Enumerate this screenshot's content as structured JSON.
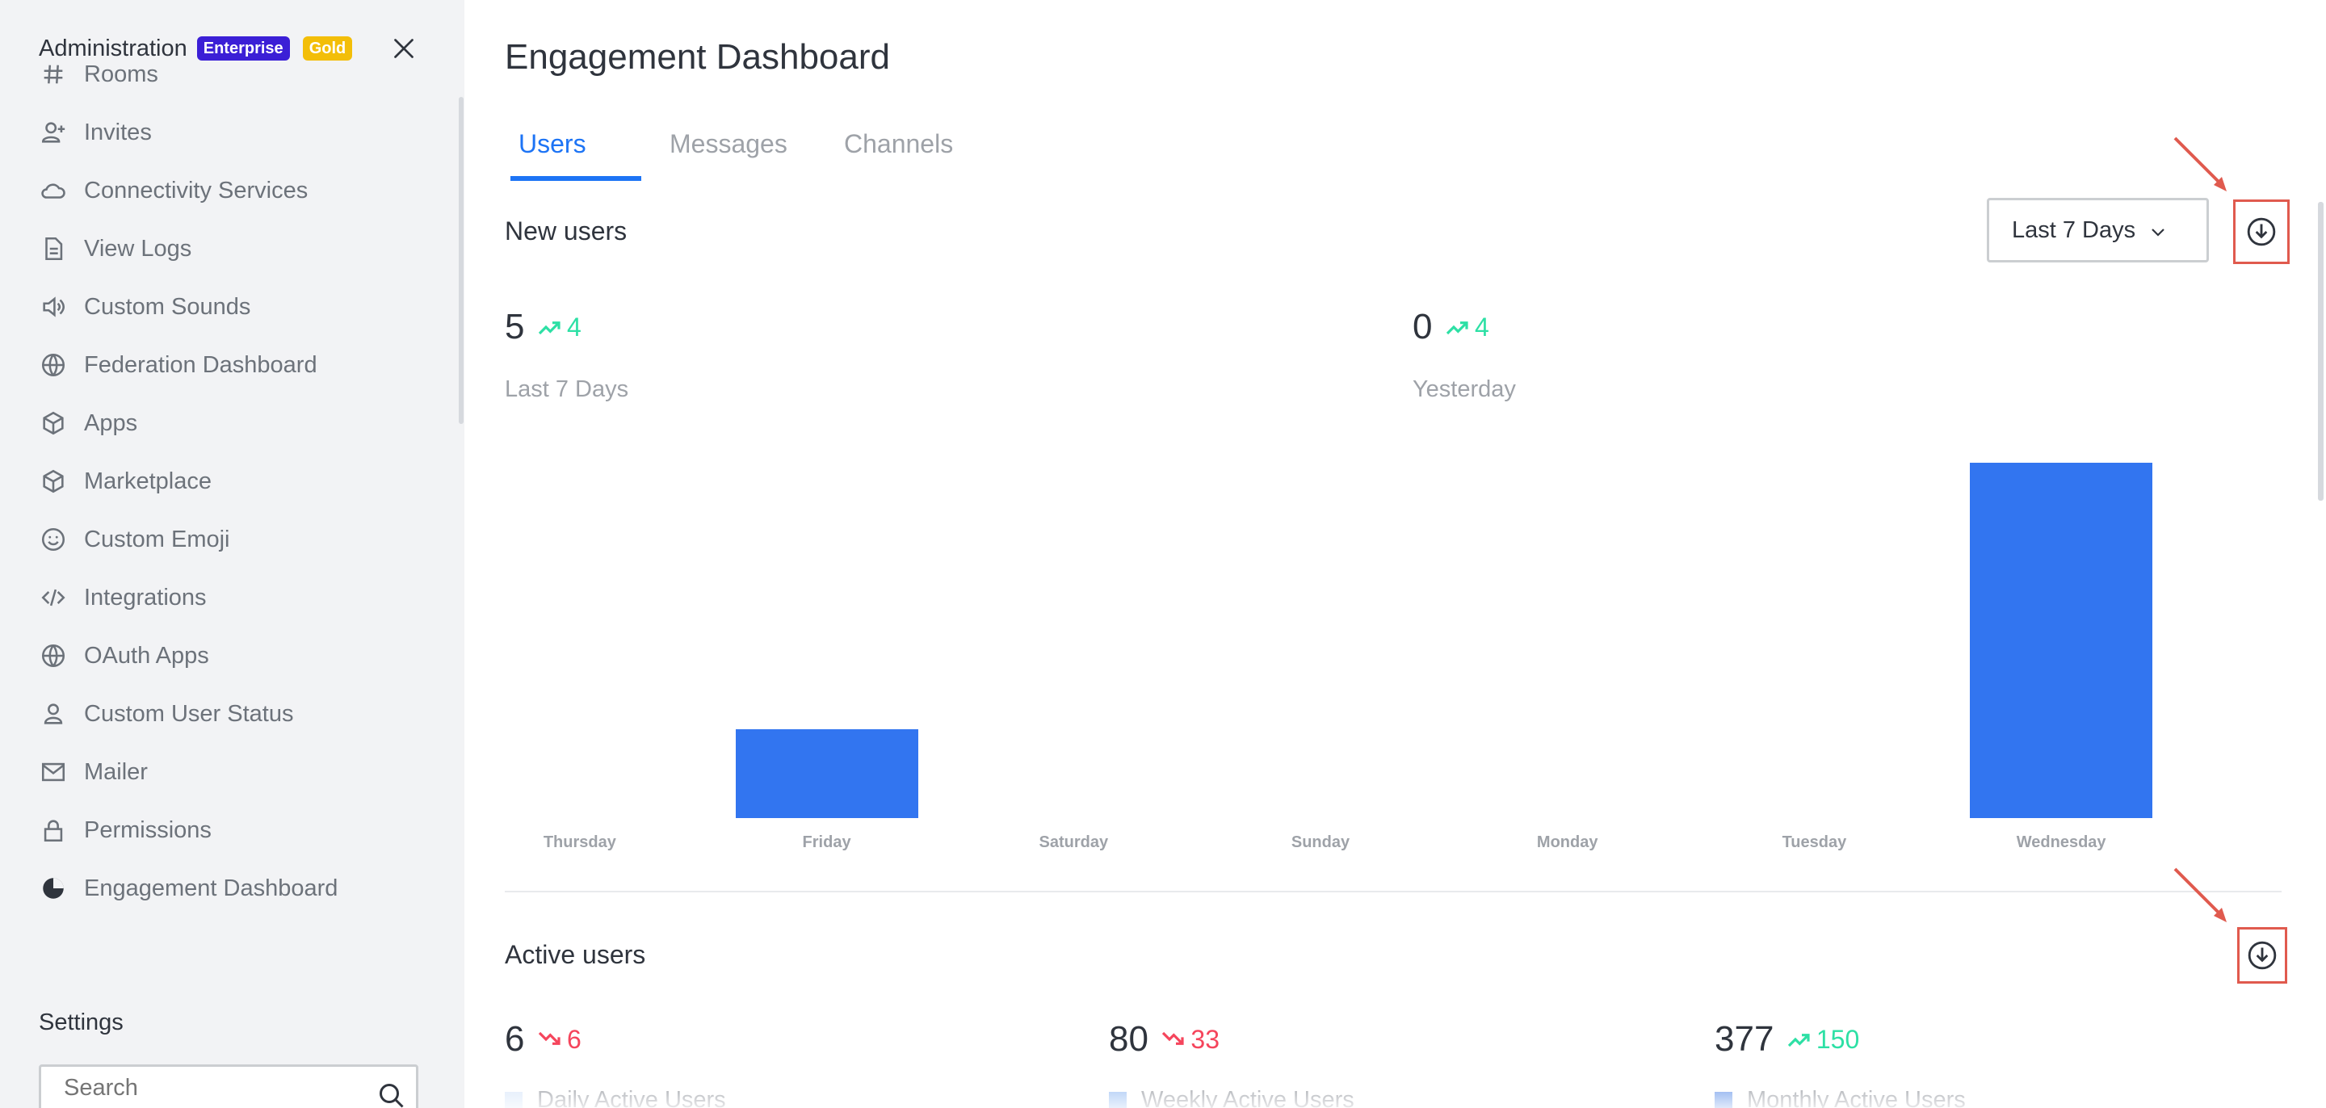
{
  "sidebar": {
    "title": "Administration",
    "badges": [
      "Enterprise",
      "Gold"
    ],
    "items": [
      {
        "label": "Rooms",
        "icon": "hashtag-icon"
      },
      {
        "label": "Invites",
        "icon": "user-plus-icon"
      },
      {
        "label": "Connectivity Services",
        "icon": "cloud-icon"
      },
      {
        "label": "View Logs",
        "icon": "file-icon"
      },
      {
        "label": "Custom Sounds",
        "icon": "speaker-icon"
      },
      {
        "label": "Federation Dashboard",
        "icon": "globe-icon"
      },
      {
        "label": "Apps",
        "icon": "cube-icon"
      },
      {
        "label": "Marketplace",
        "icon": "cube-icon"
      },
      {
        "label": "Custom Emoji",
        "icon": "emoji-icon"
      },
      {
        "label": "Integrations",
        "icon": "code-icon"
      },
      {
        "label": "OAuth Apps",
        "icon": "globe-icon"
      },
      {
        "label": "Custom User Status",
        "icon": "user-icon"
      },
      {
        "label": "Mailer",
        "icon": "mail-icon"
      },
      {
        "label": "Permissions",
        "icon": "lock-icon"
      },
      {
        "label": "Engagement Dashboard",
        "icon": "pie-chart-icon"
      }
    ],
    "settings_label": "Settings",
    "search_placeholder": "Search"
  },
  "main": {
    "title": "Engagement Dashboard",
    "tabs": [
      {
        "label": "Users",
        "active": true
      },
      {
        "label": "Messages",
        "active": false
      },
      {
        "label": "Channels",
        "active": false
      }
    ],
    "new_users": {
      "title": "New users",
      "period_select": "Last 7 Days",
      "metrics": [
        {
          "value": "5",
          "delta": "4",
          "trend": "up",
          "label": "Last 7 Days"
        },
        {
          "value": "0",
          "delta": "4",
          "trend": "up",
          "label": "Yesterday"
        }
      ]
    },
    "active_users": {
      "title": "Active users",
      "metrics": [
        {
          "value": "6",
          "delta": "6",
          "trend": "down",
          "label": "Daily Active Users",
          "color": "#c9ddf8"
        },
        {
          "value": "80",
          "delta": "33",
          "trend": "down",
          "label": "Weekly Active Users",
          "color": "#6fa3ee"
        },
        {
          "value": "377",
          "delta": "150",
          "trend": "up",
          "label": "Monthly Active Users",
          "color": "#2d6de1"
        }
      ]
    }
  },
  "colors": {
    "accent": "#1d74f5",
    "bar": "#3275f0",
    "trend_up": "#2de0a5",
    "trend_down": "#f5455c",
    "highlight": "#e05a4e"
  },
  "chart_data": {
    "type": "bar",
    "categories": [
      "Thursday",
      "Friday",
      "Saturday",
      "Sunday",
      "Monday",
      "Tuesday",
      "Wednesday"
    ],
    "values": [
      0,
      1,
      0,
      0,
      0,
      0,
      4
    ],
    "ylim": [
      0,
      4
    ]
  }
}
